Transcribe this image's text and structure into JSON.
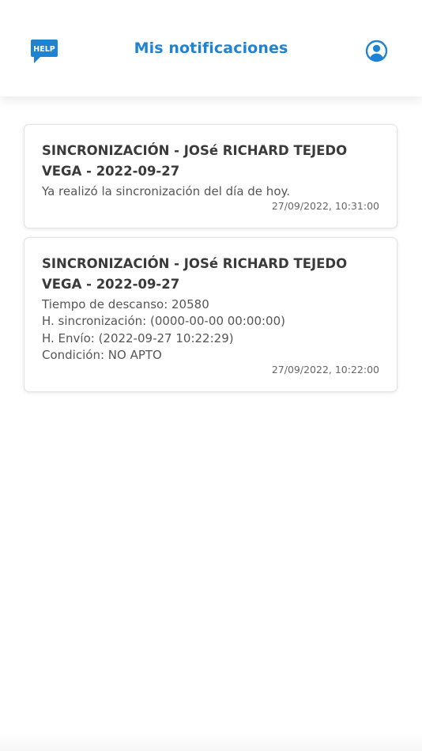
{
  "header": {
    "title": "Mis notificaciones",
    "help_icon_text": "HELP",
    "accent_color": "#1f83d4"
  },
  "notifications": [
    {
      "title": "SINCRONIZACIÓN - JOSé RICHARD TEJEDO VEGA - 2022-09-27",
      "body": "Ya realizó la sincronización del día de hoy.",
      "timestamp": "27/09/2022, 10:31:00"
    },
    {
      "title": "SINCRONIZACIÓN - JOSé RICHARD TEJEDO VEGA - 2022-09-27",
      "body": "Tiempo de descanso: 20580\n H. sincronización: (0000-00-00 00:00:00)\n H. Envío: (2022-09-27 10:22:29)\n Condición: NO APTO",
      "timestamp": "27/09/2022, 10:22:00"
    }
  ]
}
